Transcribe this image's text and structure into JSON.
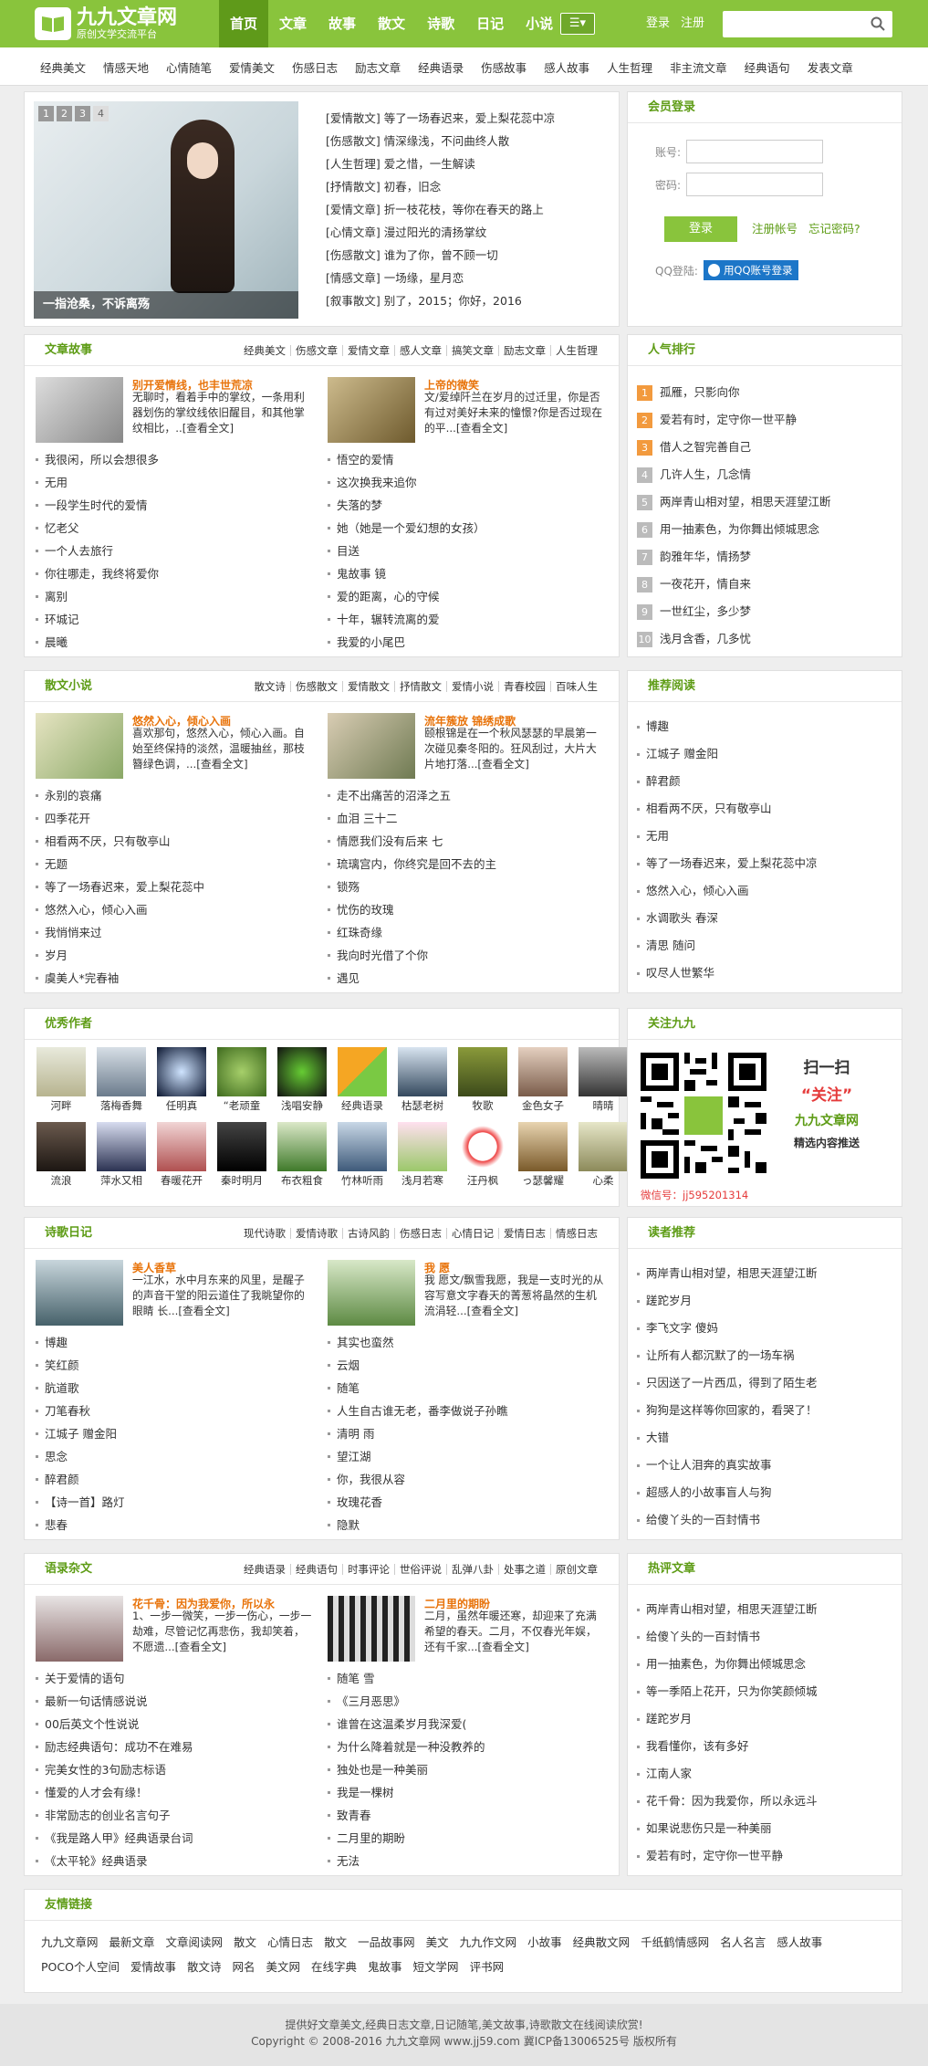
{
  "site": {
    "title": "九九文章网",
    "subtitle": "原创文学交流平台"
  },
  "nav": {
    "items": [
      "首页",
      "文章",
      "故事",
      "散文",
      "诗歌",
      "日记",
      "小说"
    ],
    "active": "首页",
    "auth_login": "登录",
    "auth_register": "注册",
    "search_placeholder": ""
  },
  "subnav": [
    "经典美文",
    "情感天地",
    "心情随笔",
    "爱情美文",
    "伤感日志",
    "励志文章",
    "经典语录",
    "伤感故事",
    "感人故事",
    "人生哲理",
    "非主流文章",
    "经典语句",
    "发表文章"
  ],
  "slider": {
    "numbers": [
      "1",
      "2",
      "3",
      "4"
    ],
    "caption": "一指沧桑，不诉离殇"
  },
  "headlines": [
    "[爱情散文] 等了一场春迟来，爱上梨花蕊中凉",
    "[伤感散文] 情深缘浅，不问曲终人散",
    "[人生哲理] 爱之惜，一生解读",
    "[抒情散文] 初春，旧念",
    "[爱情文章] 折一枝花枝，等你在春天的路上",
    "[心情文章] 漫过阳光的清扬掌纹",
    "[伤感散文] 谁为了你，曾不顾一切",
    "[情感文章] 一场缘，星月恋",
    "[叙事散文] 别了，2015；你好，2016"
  ],
  "login": {
    "title": "会员登录",
    "account_label": "账号:",
    "password_label": "密码:",
    "button": "登录",
    "register": "注册帐号",
    "forgot": "忘记密码?",
    "qq_label": "QQ登陆:",
    "qq_button": "用QQ账号登录"
  },
  "wenzhang": {
    "title": "文章故事",
    "tabs": [
      "经典美文",
      "伤感文章",
      "爱情文章",
      "感人文章",
      "搞笑文章",
      "励志文章",
      "人生哲理"
    ],
    "story1": {
      "title": "别开爱情线，也丰世荒凉",
      "body": "无聊时，看着手中的掌纹，一条用利器划伤的掌纹线依旧醒目，和其他掌纹相比，..[查看全文]"
    },
    "story2": {
      "title": "上帝的微笑",
      "body": "文/爱绰阡兰在岁月的过迁里，你是否有过对美好未来的憧憬?你是否过现在的平...[查看全文]"
    },
    "list1": [
      "我很闲，所以会想很多",
      "无用",
      "一段学生时代的爱情",
      "忆老父",
      "一个人去旅行",
      "你往哪走，我终将爱你",
      "离别",
      "环城记",
      "晨曦"
    ],
    "list2": [
      "悟空的爱情",
      "这次换我来追你",
      "失落的梦",
      "她（她是一个爱幻想的女孩）",
      "目送",
      "鬼故事 镜",
      "爱的距离，心的守候",
      "十年，辗转流离的爱",
      "我爱的小尾巴"
    ]
  },
  "rank": {
    "title": "人气排行",
    "items": [
      "孤雁，只影向你",
      "爱若有时，定守你一世平静",
      "借人之智完善自己",
      "几许人生，几念情",
      "两岸青山相对望，相思天涯望江断",
      "用一抽素色，为你舞出倾城思念",
      "韵雅年华，情扬梦",
      "一夜花开，情自来",
      "一世红尘，多少梦",
      "浅月含香，几多忧"
    ]
  },
  "sanwen": {
    "title": "散文小说",
    "tabs": [
      "散文诗",
      "伤感散文",
      "爱情散文",
      "抒情散文",
      "爱情小说",
      "青春校园",
      "百味人生"
    ],
    "story1": {
      "title": "悠然入心，倾心入画",
      "body": "喜欢那句，悠然入心，倾心入画。自始至终保持的淡然，温暖抽丝，那枝簪绿色调，...[查看全文]"
    },
    "story2": {
      "title": "流年簇放 锦绣成歌",
      "body": "颐根锦是在一个秋风瑟瑟的早晨第一次碰见秦冬阳的。狂风刮过，大片大片地打落...[查看全文]"
    },
    "list1": [
      "永别的哀痛",
      "四季花开",
      "相看两不厌，只有敬亭山",
      "无题",
      "等了一场春迟来，爱上梨花蕊中",
      "悠然入心，倾心入画",
      "我悄悄来过",
      "岁月",
      "虞美人*完春袖"
    ],
    "list2": [
      "走不出痛苦的沼泽之五",
      "血泪 三十二",
      "情愿我们没有后来 七",
      "琉璃宫内，你终究是回不去的主",
      "锁殇",
      "忧伤的玫瑰",
      "红珠奇缘",
      "我向时光借了个你",
      "遇见"
    ]
  },
  "tuijian": {
    "title": "推荐阅读",
    "items": [
      "博趣",
      "江城子 赠金阳",
      "醉君颜",
      "相看两不厌，只有敬亭山",
      "无用",
      "等了一场春迟来，爱上梨花蕊中凉",
      "悠然入心，倾心入画",
      "水调歌头 春深",
      "清思 随问",
      "叹尽人世繁华"
    ]
  },
  "authors": {
    "title": "优秀作者",
    "names": [
      "河畔",
      "落梅香舞",
      "任明真",
      "“老顽童",
      "浅唱安静",
      "经典语录",
      "枯瑟老树",
      "牧歌",
      "金色女子",
      "晴晴",
      "流浪",
      "萍水又相",
      "春暖花开",
      "秦时明月",
      "布衣粗食",
      "竹林听雨",
      "浅月若寒",
      "汪丹枫",
      "っ瑟馨耀",
      "心柔"
    ]
  },
  "follow": {
    "title": "关注九九",
    "wechat": "微信号：jj595201314",
    "slogan1": "扫一扫",
    "slogan2": "“关注”",
    "slogan3": "九九文章网",
    "slogan4": "精选内容推送"
  },
  "shige": {
    "title": "诗歌日记",
    "tabs": [
      "现代诗歌",
      "爱情诗歌",
      "古诗风韵",
      "伤感日志",
      "心情日记",
      "爱情日志",
      "情感日志"
    ],
    "story1": {
      "title": "美人香草",
      "body": "一江水，水中月东来的风里，是醒子的声音干堂的阳云道住了我眺望你的眼睛 长...[查看全文]"
    },
    "story2": {
      "title": "我 愿",
      "body": "我 愿文/飘雪我愿，我是一支时光的从容写意文字春天的菁葱将晶然的生机流涓轻...[查看全文]"
    },
    "list1": [
      "博趣",
      "笑红颜",
      "肮道歌",
      "刀笔春秋",
      "江城子 赠金阳",
      "思念",
      "醉君颜",
      "【诗一首】路灯",
      "悲春"
    ],
    "list2": [
      "其实也蛮然",
      "云烟",
      "随笔",
      "人生自古谁无老，番李做说子孙瞧",
      "清明 雨",
      "望江湖",
      "你，我很从容",
      "玫瑰花香",
      "隐默"
    ]
  },
  "duzhe": {
    "title": "读者推荐",
    "items": [
      "两岸青山相对望，相思天涯望江断",
      "蹉跎岁月",
      "李飞文字 傻妈",
      "让所有人都沉默了的一场车祸",
      "只因送了一片西瓜，得到了陌生老",
      "狗狗是这样等你回家的，看哭了！",
      "大错",
      "一个让人泪奔的真实故事",
      "超感人的小故事盲人与狗",
      "给傻丫头的一百封情书"
    ]
  },
  "yulu": {
    "title": "语录杂文",
    "tabs": [
      "经典语录",
      "经典语句",
      "时事评论",
      "世俗评说",
      "乱弹八卦",
      "处事之道",
      "原创文章"
    ],
    "story1": {
      "title": "花千骨：因为我爱你，所以永",
      "body": "1、一步一微笑，一步一伤心，一步一劫难，尽管记忆再悲伤，我却笑着，不愿遗...[查看全文]"
    },
    "story2": {
      "title": "二月里的期盼",
      "body": "二月，虽然年暖还寒，却迎来了充满希望的春天。二月，不仅春光年娱，还有千家...[查看全文]"
    },
    "list1": [
      "关于爱情的语句",
      "最新一句话情感说说",
      "00后英文个性说说",
      "励志经典语句：成功不在难易",
      "完美女性的3句励志标语",
      "懂爱的人才会有缘！",
      "非常励志的创业名言句子",
      "《我是路人甲》经典语录台词",
      "《太平轮》经典语录"
    ],
    "list2": [
      "随笔 雪",
      "《三月恶思》",
      "谁曾在这温柔岁月我深爱(",
      "为什么降着就是一种没教养的",
      "独处也是一种美丽",
      "我是一棵树",
      "致青春",
      "二月里的期盼",
      "无法"
    ]
  },
  "hotcomment": {
    "title": "热评文章",
    "items": [
      "两岸青山相对望，相思天涯望江断",
      "给傻丫头的一百封情书",
      "用一抽素色，为你舞出倾城思念",
      "等一季陌上花开，只为你笑颜倾城",
      "蹉跎岁月",
      "我看懂你，该有多好",
      "江南人家",
      "花千骨：因为我爱你，所以永远斗",
      "如果说悲伤只是一种美丽",
      "爱若有时，定守你一世平静"
    ]
  },
  "friendlinks": {
    "title": "友情链接",
    "items": [
      "九九文章网",
      "最新文章",
      "文章阅读网",
      "散文",
      "心情日志",
      "散文",
      "一品故事网",
      "美文",
      "九九作文网",
      "小故事",
      "经典散文网",
      "千纸鹤情感网",
      "名人名言",
      "感人故事",
      "POCO个人空间",
      "爱情故事",
      "散文诗",
      "网名",
      "美文网",
      "在线字典",
      "鬼故事",
      "短文学网",
      "评书网"
    ]
  },
  "footer": {
    "line1": "提供好文章美文,经典日志文章,日记随笔,美文故事,诗歌散文在线阅读欣赏!",
    "line2": "Copyright © 2008-2016 九九文章网 www.jj59.com 冀ICP备13006525号 版权所有"
  },
  "colors": {
    "brand": "#89c43c",
    "accent_orange": "#e8730a",
    "title_green": "#5e9c16"
  }
}
